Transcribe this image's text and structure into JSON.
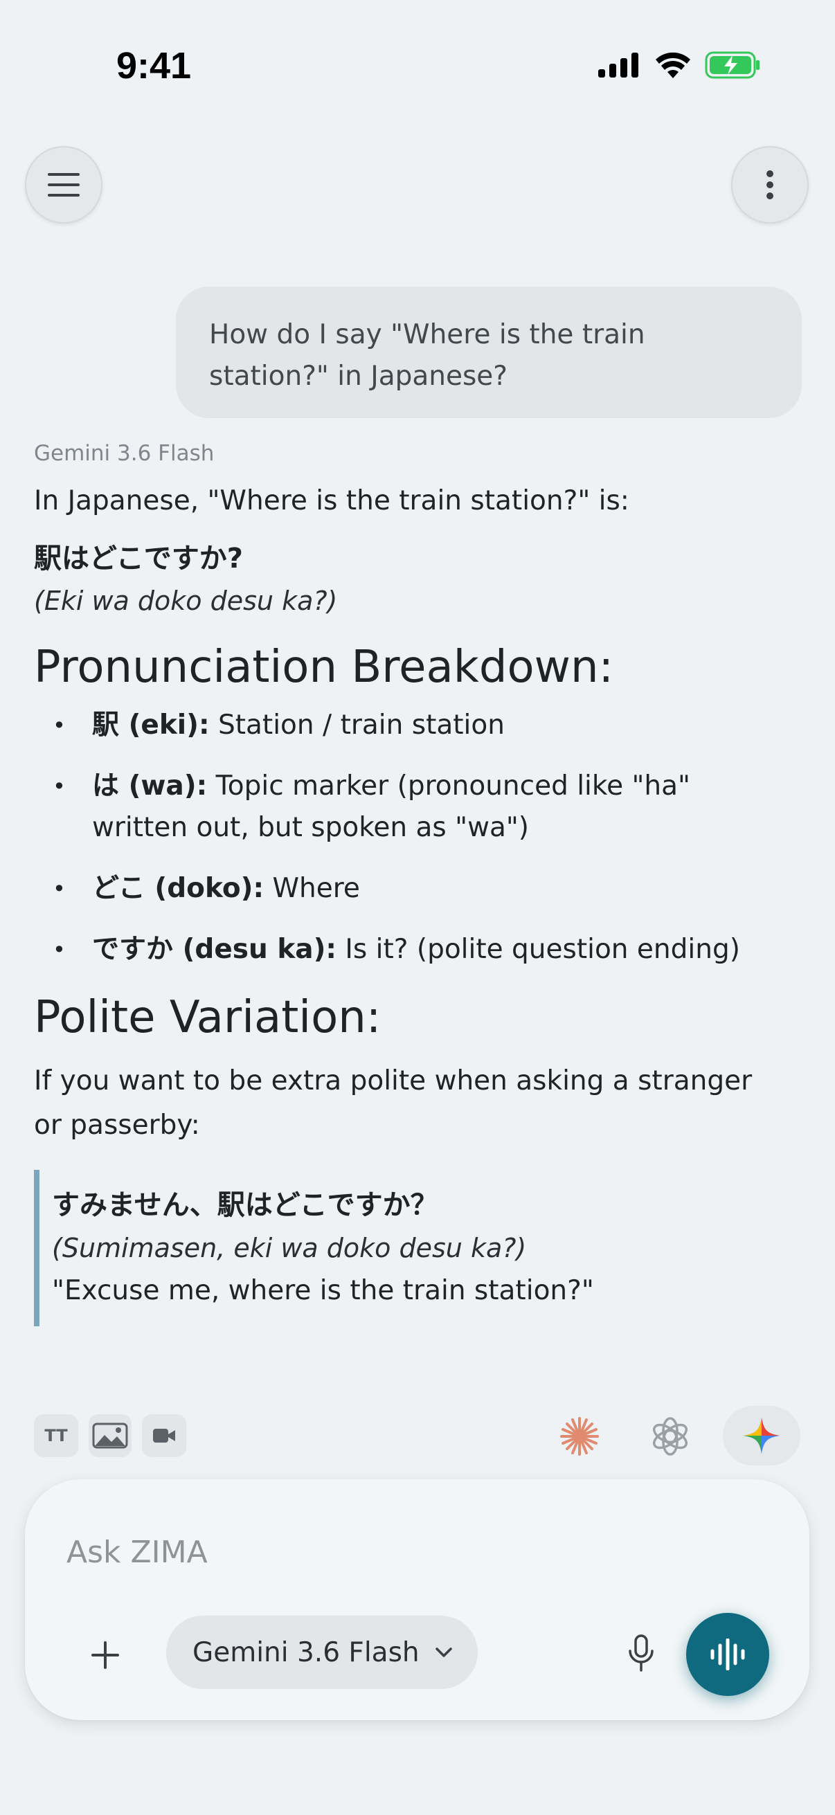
{
  "status_bar": {
    "time": "9:41",
    "icons": [
      "cellular-signal-icon",
      "wifi-icon",
      "battery-charging-icon"
    ]
  },
  "header": {
    "menu_icon": "hamburger-menu-icon",
    "more_icon": "vertical-dots-icon"
  },
  "conversation": {
    "user_message": "How do I say \"Where is the train station?\" in Japanese?",
    "response": {
      "model_name": "Gemini 3.6 Flash",
      "intro": "In Japanese, \"Where is the train station?\" is:",
      "phrase_japanese": "駅はどこですか?",
      "phrase_romaji": "(Eki wa doko desu ka?)",
      "breakdown_heading": "Pronunciation Breakdown:",
      "breakdown": [
        {
          "term": "駅 (eki):",
          "meaning": "Station / train station"
        },
        {
          "term": "は (wa):",
          "meaning": "Topic marker (pronounced like \"ha\" written out, but spoken as \"wa\")"
        },
        {
          "term": "どこ (doko):",
          "meaning": "Where"
        },
        {
          "term": "ですか (desu ka):",
          "meaning": "Is it? (polite question ending)"
        }
      ],
      "polite_heading": "Polite Variation:",
      "polite_intro": "If you want to be extra polite when asking a stranger or passerby:",
      "polite_quote": {
        "japanese": "すみません、駅はどこですか？",
        "romaji": "(Sumimasen, eki wa doko desu ka?)",
        "english": "\"Excuse me, where is the train station?\""
      }
    }
  },
  "tools": {
    "text_label": "TT",
    "items": [
      "text-format-icon",
      "image-icon",
      "video-icon"
    ],
    "ai_providers": [
      "claude-icon",
      "openai-icon",
      "gemini-icon"
    ]
  },
  "composer": {
    "placeholder": "Ask ZIMA",
    "model_selected": "Gemini 3.6 Flash",
    "colors": {
      "voice_button": "#0f6a80"
    }
  }
}
